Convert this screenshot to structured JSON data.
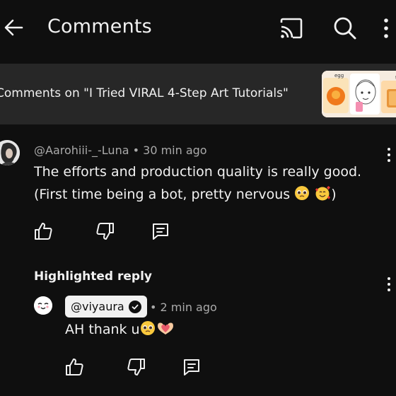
{
  "app_bar": {
    "title": "Comments"
  },
  "video": {
    "context_text": "Comments on \"I Tried VIRAL 4-Step Art Tutorials\"",
    "thumbnail_labels": [
      "egg",
      "toast"
    ]
  },
  "comment": {
    "author": "@Aarohiii-_-Luna",
    "time": "30 min ago",
    "separator": "•",
    "line1": "The efforts and production quality is really good.",
    "line2": "(First time being a bot, pretty nervous",
    "line2_end": ")"
  },
  "highlighted": {
    "label": "Highlighted reply"
  },
  "reply": {
    "author": "@viyaura",
    "separator": "•",
    "time": "2 min ago",
    "text": "AH thank u"
  },
  "colors": {
    "background": "#0f0f0f",
    "surface": "#272727",
    "text_primary": "#f1f1f1",
    "text_secondary": "#aaaaaa"
  },
  "icons": [
    "back-arrow-icon",
    "cast-icon",
    "search-icon",
    "more-vert-icon",
    "like-icon",
    "dislike-icon",
    "reply-icon",
    "verified-check-icon",
    "pleading-face-emoji",
    "smiling-face-hearts-emoji",
    "heart-hands-emoji"
  ]
}
